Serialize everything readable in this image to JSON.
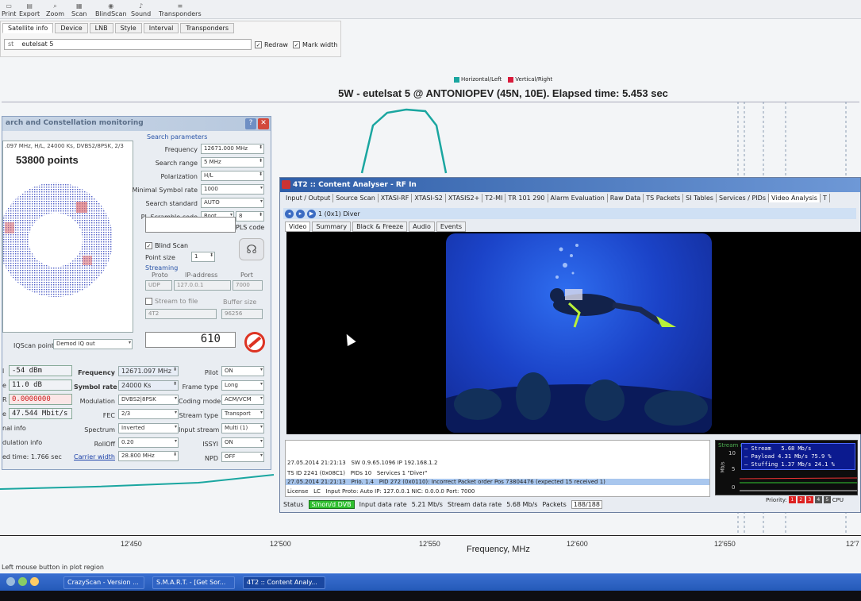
{
  "toolbar": {
    "items": [
      "Print",
      "Export",
      "Zoom",
      "Scan",
      "BlindScan",
      "Sound",
      "Transponders"
    ]
  },
  "settings": {
    "tabs": [
      "Satellite info",
      "Device",
      "LNB",
      "Style",
      "Interval",
      "Transponders"
    ],
    "satellite_value": "eutelsat 5",
    "satellite_prefix": "st",
    "redraw_label": "Redraw",
    "markwidth_label": "Mark width"
  },
  "chart": {
    "legend": [
      "Horizontal/Left",
      "Vertical/Right"
    ],
    "title": "5W - eutelsat 5 @ ANTONIOPEV (45N, 10E). Elapsed time: 5.453 sec",
    "x_ticks": [
      "12'450",
      "12'500",
      "12'550",
      "12'600",
      "12'650",
      "12'7"
    ],
    "x_label": "Frequency, MHz",
    "status": "Left mouse button in plot region"
  },
  "chart_data": {
    "type": "line",
    "title": "5W - eutelsat 5 @ ANTONIOPEV (45N, 10E). Elapsed time: 5.453 sec",
    "xlabel": "Frequency, MHz",
    "series": [
      {
        "name": "Horizontal/Left",
        "color": "#1aa6a0"
      },
      {
        "name": "Vertical/Right",
        "color": "#d81b3c"
      }
    ]
  },
  "dialog": {
    "title": "arch and Constellation monitoring",
    "const_sub": ".097 MHz, H/L, 24000 Ks, DVBS2/8PSK, 2/3",
    "points": "53800 points",
    "search_params_label": "Search parameters",
    "params": [
      {
        "label": "Frequency",
        "value": "12671.000 MHz"
      },
      {
        "label": "Search range",
        "value": "5 MHz"
      },
      {
        "label": "Polarization",
        "value": "H/L"
      },
      {
        "label": "Minimal Symbol rate",
        "value": "1000"
      },
      {
        "label": "Search standard",
        "value": "AUTO"
      },
      {
        "label": "PL Scramble code",
        "value": "Root",
        "extra": "8"
      }
    ],
    "search_pls": "Search PLS code",
    "blind_scan": "Blind Scan",
    "point_size_label": "Point size",
    "point_size": "1",
    "streaming_label": "Streaming",
    "proto_label": "Proto",
    "ip_label": "IP-address",
    "port_label": "Port",
    "proto": "UDP",
    "ip": "127.0.0.1",
    "port": "7000",
    "stream_to_file": "Stream to file",
    "buffer_size_label": "Buffer size",
    "file_value": "4T2",
    "buffer_value": "96256",
    "iqscan_label": "IQScan point",
    "iqscan_value": "Demod IQ out",
    "lcd_value": "610",
    "indicators": [
      {
        "label": "l",
        "value": "-54 dBm"
      },
      {
        "label": "e",
        "value": "11.0 dB"
      },
      {
        "label": "R",
        "value": "0.0000000"
      },
      {
        "label": "e",
        "value": "47.544 Mbit/s"
      }
    ],
    "nal_info": "nal info",
    "modulation_info": "dulation info",
    "elapsed": "ed time: 1.766 sec",
    "mid": [
      {
        "label": "Frequency",
        "value": "12671.097 MHz"
      },
      {
        "label": "Symbol rate",
        "value": "24000 Ks"
      },
      {
        "label": "Modulation",
        "value": "DVBS2|8PSK"
      },
      {
        "label": "FEC",
        "value": "2/3"
      },
      {
        "label": "Spectrum",
        "value": "Inverted"
      },
      {
        "label": "RollOff",
        "value": "0.20"
      },
      {
        "label": "Carrier width",
        "value": "28.800 MHz"
      }
    ],
    "right": [
      {
        "label": "Pilot",
        "value": "ON"
      },
      {
        "label": "Frame type",
        "value": "Long"
      },
      {
        "label": "Coding mode",
        "value": "ACM/VCM"
      },
      {
        "label": "Stream type",
        "value": "Transport"
      },
      {
        "label": "Input stream",
        "value": "Multi (1)"
      },
      {
        "label": "ISSYI",
        "value": "ON"
      },
      {
        "label": "NPD",
        "value": "OFF"
      }
    ]
  },
  "analyser": {
    "title": "4T2 :: Content Analyser - RF In",
    "tabs": [
      "Input / Output",
      "Source Scan",
      "XTASI-RF",
      "XTASI-S2",
      "XTASIS2+",
      "T2-MI",
      "TR 101 290",
      "Alarm Evaluation",
      "Raw Data",
      "TS Packets",
      "SI Tables",
      "Services / PIDs",
      "Video Analysis",
      "T"
    ],
    "nav_item": "1 (0x1) Diver",
    "sub_tabs": [
      "Video",
      "Summary",
      "Black & Freeze",
      "Audio",
      "Events"
    ],
    "log": {
      "r1": {
        "time": "27.05.2014 21:21:13",
        "sw_label": "SW",
        "sw": "0.9.65.1096",
        "ip_label": "IP",
        "ip": "192.168.1.2"
      },
      "r2": {
        "tsid_label": "TS ID",
        "tsid": "2241 (0x08C1)",
        "pids_label": "PIDs",
        "pids": "10",
        "services_label": "Services",
        "services": "1",
        "name": "\"Diver\""
      },
      "r3": {
        "time": "27.05.2014 21:21:13",
        "prio": "Prio. 1.4",
        "msg": "PID 272 (0x0110): Incorrect Packet order Pos 73804476 (expected 15 received 1)"
      },
      "r4": {
        "license_label": "License",
        "license": "LC",
        "input_label": "Input",
        "input": "Proto: Auto IP: 127.0.0.1 NIC: 0.0.0.0 Port: 7000"
      }
    },
    "status": {
      "label": "Status",
      "badge": "S/non/d DVB",
      "input_rate_label": "Input data rate",
      "input_rate": "5.21 Mb/s",
      "stream_rate_label": "Stream data rate",
      "stream_rate": "5.68 Mb/s",
      "packets_label": "Packets",
      "packets": "188/188"
    },
    "stream": {
      "title": "Stream data",
      "rows": [
        {
          "name": "Stream",
          "value": "5.68 Mb/s",
          "pct": ""
        },
        {
          "name": "Payload",
          "value": "4.31 Mb/s",
          "pct": "75.9 %"
        },
        {
          "name": "Stuffing",
          "value": "1.37 Mb/s",
          "pct": "24.1 %"
        }
      ],
      "axis": [
        "10",
        "5",
        "0"
      ],
      "unit": "Mb/s"
    },
    "priority_label": "Priority:",
    "priorities": [
      "1",
      "2",
      "3",
      "4",
      "5"
    ],
    "cpu_label": "CPU"
  },
  "taskbar": {
    "items": [
      "CrazyScan - Version ...",
      "S.M.A.R.T. - [Get Sor...",
      "4T2 :: Content Analy..."
    ]
  }
}
